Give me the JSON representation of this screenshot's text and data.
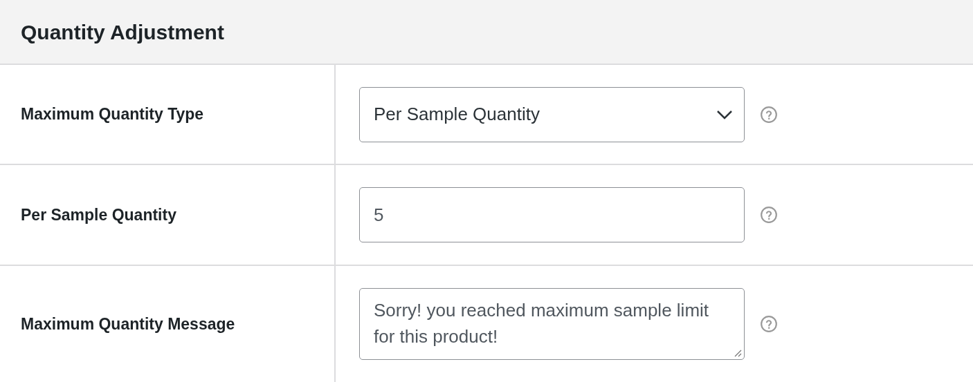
{
  "section": {
    "title": "Quantity Adjustment"
  },
  "rows": [
    {
      "label": "Maximum Quantity Type",
      "kind": "select",
      "value": "Per Sample Quantity"
    },
    {
      "label": "Per Sample Quantity",
      "kind": "input",
      "value": "5"
    },
    {
      "label": "Maximum Quantity Message",
      "kind": "textarea",
      "value": "Sorry! you reached maximum sample limit for this product!"
    }
  ]
}
